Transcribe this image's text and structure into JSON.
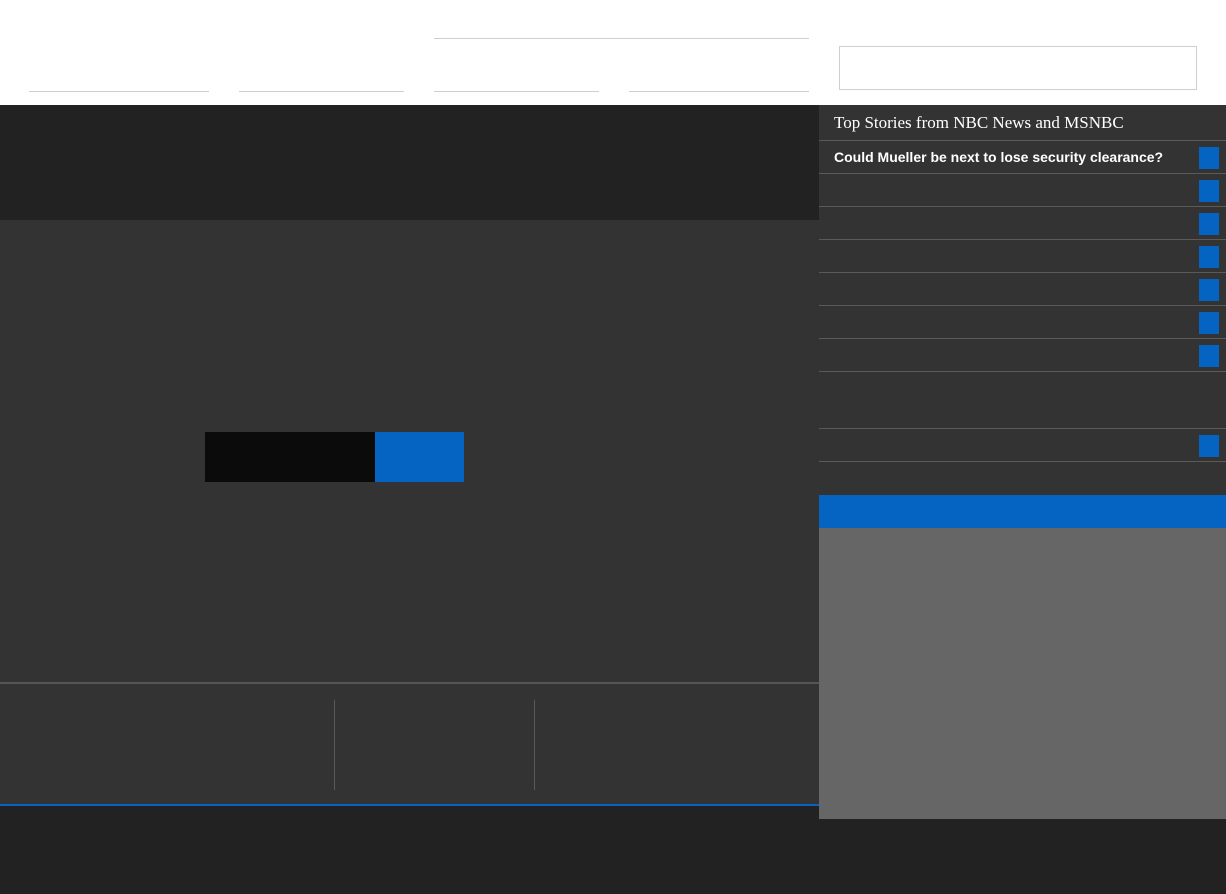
{
  "search": {
    "placeholder": "",
    "value": ""
  },
  "sidebar": {
    "title": "Top Stories from NBC News and MSNBC",
    "stories": [
      {
        "label": "Could Mueller be next to lose security clearance?"
      },
      {
        "label": ""
      },
      {
        "label": ""
      },
      {
        "label": ""
      },
      {
        "label": ""
      },
      {
        "label": ""
      },
      {
        "label": ""
      },
      {
        "label": ""
      },
      {
        "label": ""
      }
    ]
  },
  "colors": {
    "accent": "#0563c1",
    "header_bg": "#ffffff",
    "page_bg": "#222222",
    "panel_bg": "#333333",
    "ad_placeholder": "#666666"
  }
}
